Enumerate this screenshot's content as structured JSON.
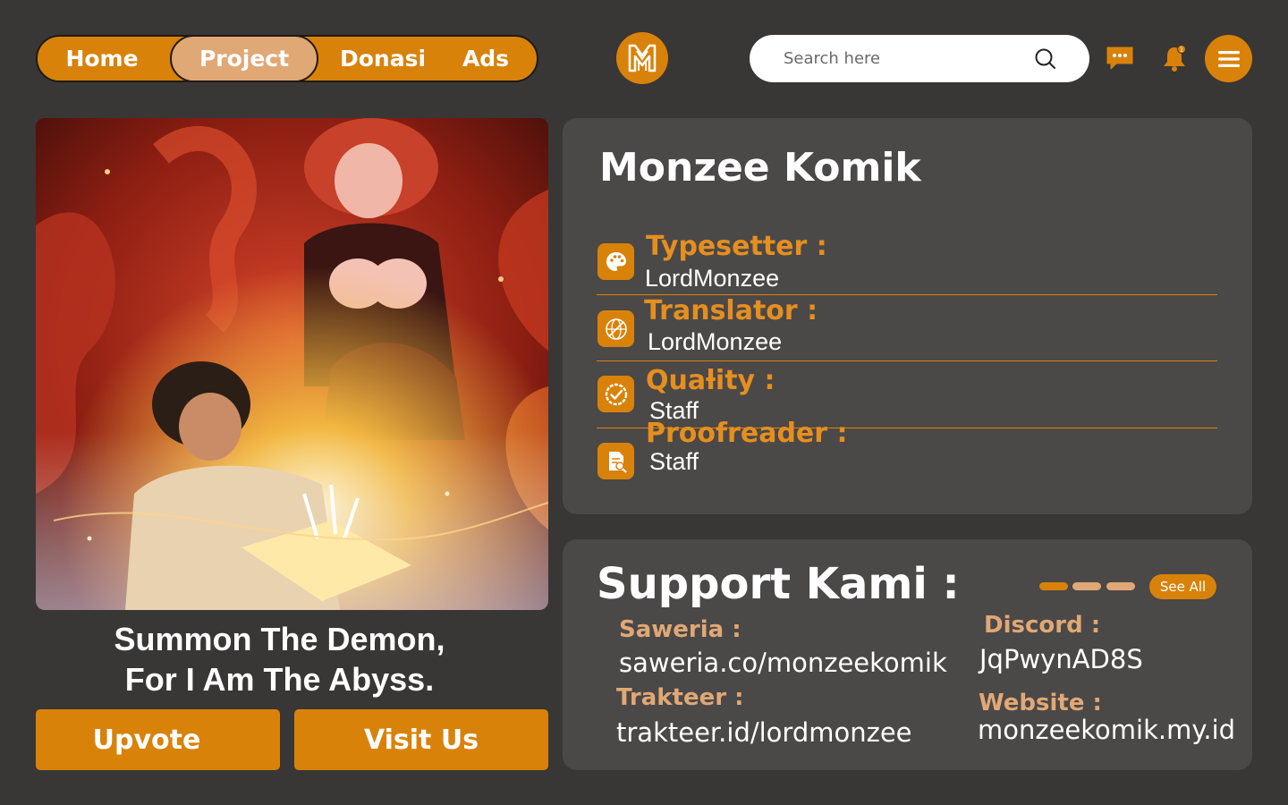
{
  "nav": {
    "items": [
      {
        "label": "Home"
      },
      {
        "label": "Project"
      },
      {
        "label": "Donasi"
      },
      {
        "label": "Ads"
      }
    ],
    "active": "Project"
  },
  "search": {
    "placeholder": "Search here",
    "value": ""
  },
  "notifications": {
    "count": "1"
  },
  "series": {
    "title_line1": "Summon The Demon,",
    "title_line2": "For I Am The Abyss."
  },
  "actions": {
    "upvote_label": "Upvote",
    "visit_label": "Visit Us"
  },
  "info": {
    "group_name": "Monzee Komik",
    "roles": [
      {
        "label": "Typesetter :",
        "value": "LordMonzee",
        "icon": "palette-icon"
      },
      {
        "label": "Translator :",
        "value": "LordMonzee",
        "icon": "translate-globe-icon"
      },
      {
        "label": "Quaƚity :",
        "value": "Staff",
        "icon": "check-badge-icon"
      },
      {
        "label": "Proofreader :",
        "value": "Staff",
        "icon": "document-review-icon"
      }
    ]
  },
  "support": {
    "title": "Support Kami :",
    "see_all_label": "See All",
    "links": [
      {
        "label": "Saweria :",
        "value": "saweria.co/monzeekomik"
      },
      {
        "label": "Trakteer :",
        "value": "trakteer.id/lordmonzee"
      },
      {
        "label": "Discord :",
        "value": "JqPwynAD8S"
      },
      {
        "label": "Website :",
        "value": "monzeekomik.my.id"
      }
    ]
  },
  "colors": {
    "background": "#393636",
    "card": "#4b4848",
    "accent": "#d9820a",
    "accent_light": "#e0a875",
    "label_orange": "#e58f1e"
  }
}
